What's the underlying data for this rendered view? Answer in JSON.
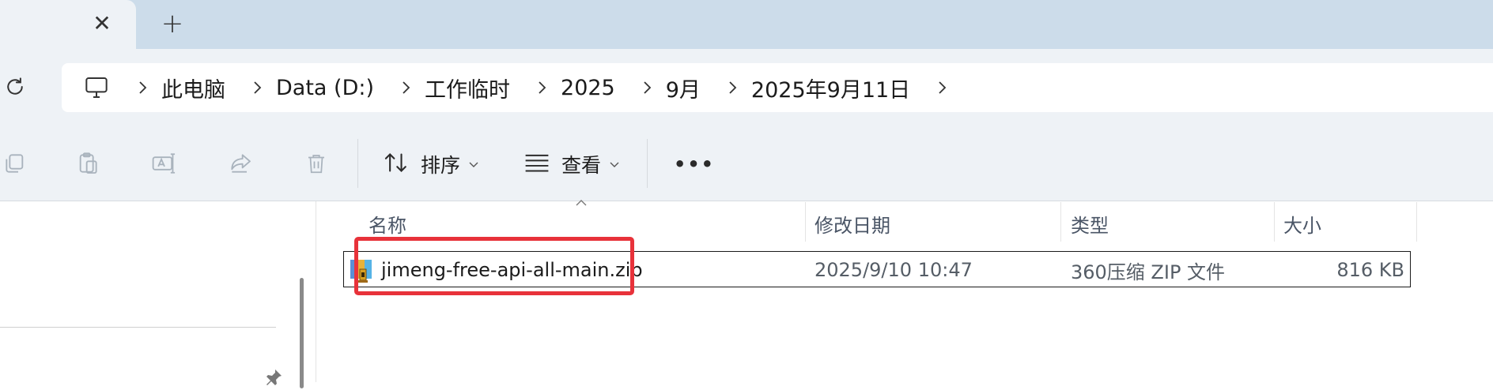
{
  "tabs": {
    "close_glyph": "✕",
    "new_glyph": "+"
  },
  "address": {
    "crumbs": [
      "此电脑",
      "Data (D:)",
      "工作临时",
      "2025",
      "9月",
      "2025年9月11日"
    ]
  },
  "toolbar": {
    "sort_label": "排序",
    "view_label": "查看",
    "more_glyph": "•••"
  },
  "file_list": {
    "columns": {
      "name": "名称",
      "modified": "修改日期",
      "type": "类型",
      "size": "大小"
    },
    "rows": [
      {
        "name": "jimeng-free-api-all-main.zip",
        "modified": "2025/9/10 10:47",
        "type": "360压缩 ZIP 文件",
        "size": "816 KB"
      }
    ]
  },
  "colors": {
    "tabstrip_bg": "#ccdcea",
    "chrome_bg": "#eef2f6",
    "highlight_red": "#e8323a"
  },
  "icons": [
    "close-icon",
    "plus-icon",
    "refresh-icon",
    "computer-icon",
    "chevron-right-icon",
    "copy-icon",
    "paste-icon",
    "rename-icon",
    "share-icon",
    "delete-icon",
    "sort-icon",
    "view-icon",
    "more-icon",
    "zip-file-icon",
    "pin-icon"
  ]
}
